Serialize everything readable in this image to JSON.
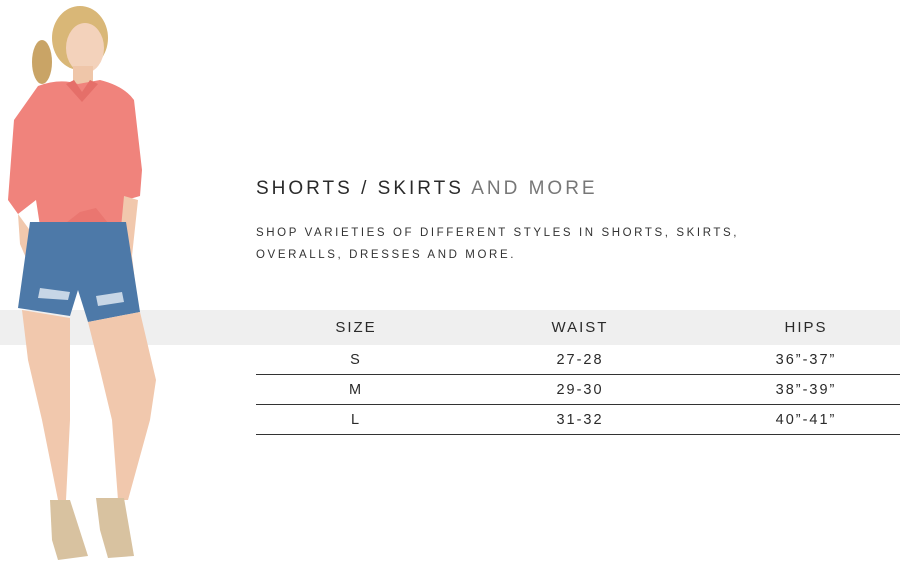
{
  "section": {
    "title_main": "SHORTS / SKIRTS",
    "title_accent": "AND MORE",
    "description_line1": "SHOP VARIETIES OF DIFFERENT STYLES IN SHORTS, SKIRTS,",
    "description_line2": "OVERALLS, DRESSES AND MORE."
  },
  "table": {
    "headers": [
      "SIZE",
      "WAIST",
      "HIPS"
    ],
    "rows": [
      [
        "S",
        "27-28",
        "36”-37”"
      ],
      [
        "M",
        "29-30",
        "38”-39”"
      ],
      [
        "L",
        "31-32",
        "40”-41”"
      ]
    ]
  },
  "colors": {
    "shirt": "#f0837c",
    "denim": "#4d79a8",
    "skin": "#f1c8ad",
    "header_band": "#efefef"
  }
}
